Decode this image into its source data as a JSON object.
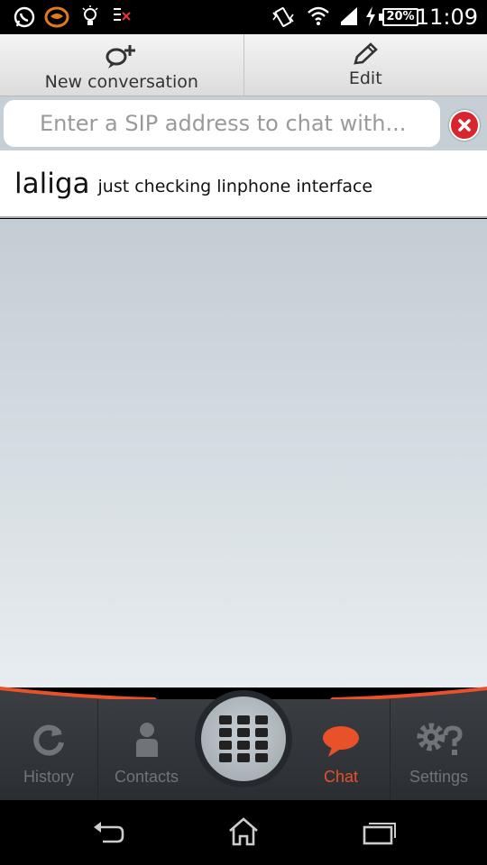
{
  "status_bar": {
    "time": "11:09",
    "battery": "20%",
    "icons": [
      "whatsapp-icon",
      "app-icon",
      "lightbulb-icon",
      "notification-icon",
      "vibrate-icon",
      "wifi-icon",
      "signal-icon",
      "charging-icon",
      "battery-icon"
    ]
  },
  "toolbar": {
    "new_conversation_label": "New conversation",
    "edit_label": "Edit"
  },
  "search": {
    "placeholder": "Enter a SIP address to chat with..."
  },
  "conversations": [
    {
      "name": "laliga",
      "message": "just checking linphone interface"
    }
  ],
  "bottom_nav": {
    "items": [
      {
        "label": "History",
        "icon": "refresh-icon"
      },
      {
        "label": "Contacts",
        "icon": "person-icon"
      },
      {
        "label": "",
        "icon": "dialpad-icon"
      },
      {
        "label": "Chat",
        "icon": "chat-bubble-icon"
      },
      {
        "label": "Settings",
        "icon": "gears-question-icon"
      }
    ],
    "active_color": "#e8512a",
    "inactive_color": "#6f747a"
  },
  "colors": {
    "accent": "#e8512a",
    "clear_button": "#d7262d"
  }
}
